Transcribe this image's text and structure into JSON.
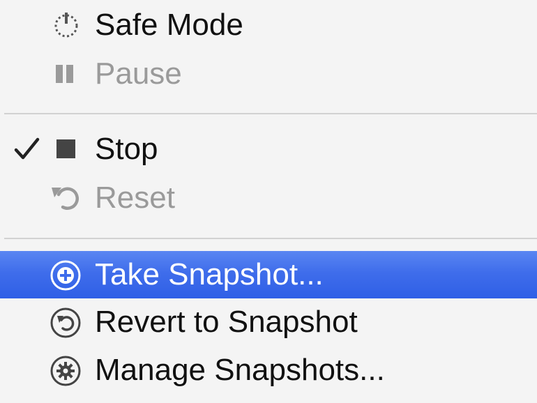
{
  "menu": {
    "items": [
      {
        "label": "Safe Mode",
        "icon": "power-icon",
        "enabled": true
      },
      {
        "label": "Pause",
        "icon": "pause-icon",
        "enabled": false
      },
      {
        "label": "Stop",
        "icon": "stop-icon",
        "enabled": true,
        "checked": true
      },
      {
        "label": "Reset",
        "icon": "reset-icon",
        "enabled": false
      },
      {
        "label": "Take Snapshot...",
        "icon": "take-snapshot-icon",
        "enabled": true,
        "highlighted": true
      },
      {
        "label": "Revert to Snapshot",
        "icon": "revert-snapshot-icon",
        "enabled": true
      },
      {
        "label": "Manage Snapshots...",
        "icon": "manage-snapshots-icon",
        "enabled": true
      }
    ]
  },
  "colors": {
    "highlight": "#3f6deb",
    "text": "#111111",
    "disabled_text": "#9a9a9a",
    "background": "#f4f4f4"
  }
}
